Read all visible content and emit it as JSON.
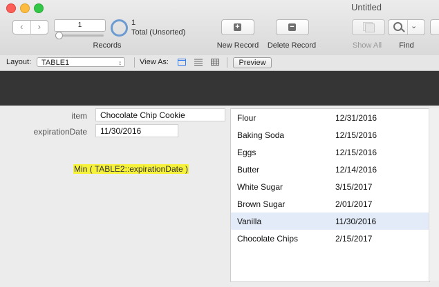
{
  "window": {
    "title": "Untitled"
  },
  "toolbar": {
    "record_number": "1",
    "found_count": "1",
    "found_status": "Total (Unsorted)",
    "records_label": "Records",
    "new_record_label": "New Record",
    "delete_record_label": "Delete Record",
    "show_all_label": "Show All",
    "find_label": "Find"
  },
  "layoutbar": {
    "layout_label": "Layout:",
    "layout_value": "TABLE1",
    "view_as_label": "View As:",
    "preview_label": "Preview"
  },
  "fields": {
    "item_label": "item",
    "item_value": "Chocolate Chip Cookie",
    "expiration_label": "expirationDate",
    "expiration_value": "11/30/2016",
    "calc_text": "Min ( TABLE2::expirationDate )"
  },
  "portal": {
    "rows": [
      {
        "name": "Flour",
        "date": "12/31/2016"
      },
      {
        "name": "Baking Soda",
        "date": "12/15/2016"
      },
      {
        "name": "Eggs",
        "date": "12/15/2016"
      },
      {
        "name": "Butter",
        "date": "12/14/2016"
      },
      {
        "name": "White Sugar",
        "date": "3/15/2017"
      },
      {
        "name": "Brown Sugar",
        "date": "2/01/2017"
      },
      {
        "name": "Vanilla",
        "date": "11/30/2016"
      },
      {
        "name": "Chocolate Chips",
        "date": "2/15/2017"
      }
    ],
    "selected_index": 6
  },
  "colors": {
    "highlight": "#f6f13b",
    "selection": "#e2ebf7",
    "header_band": "#353535"
  }
}
